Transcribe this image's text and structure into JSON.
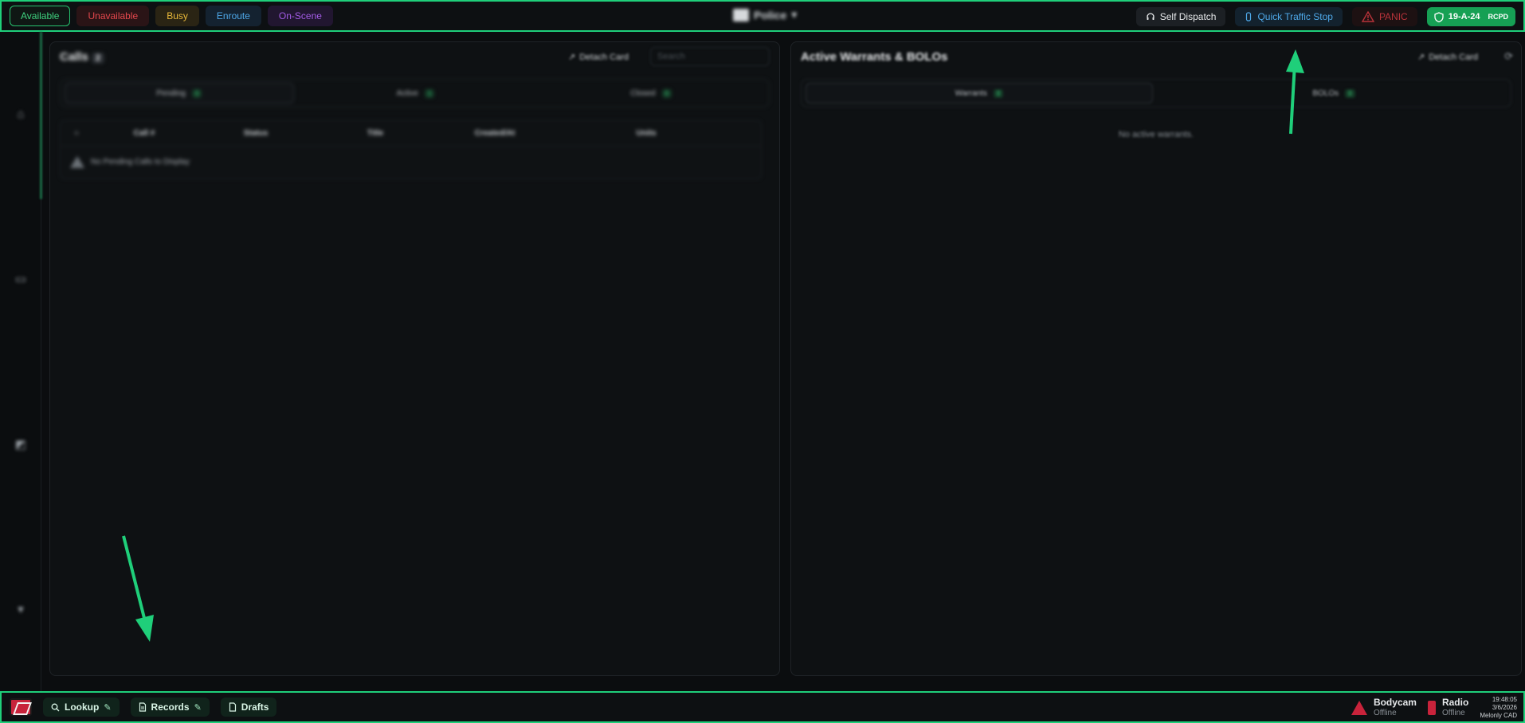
{
  "topbar": {
    "statuses": [
      {
        "label": "Available"
      },
      {
        "label": "Unavailable"
      },
      {
        "label": "Busy"
      },
      {
        "label": "Enroute"
      },
      {
        "label": "On-Scene"
      }
    ],
    "agency": "Police",
    "self_dispatch": "Self Dispatch",
    "quick_traffic_stop": "Quick Traffic Stop",
    "panic": "PANIC",
    "unit_callsign": "19-A-24",
    "unit_agency": "RCPD"
  },
  "calls_panel": {
    "title": "Calls",
    "count": "2",
    "detach": "Detach Card",
    "search_placeholder": "Search",
    "tabs": [
      {
        "label": "Pending",
        "count": "0"
      },
      {
        "label": "Active",
        "count": "1"
      },
      {
        "label": "Closed",
        "count": "0"
      }
    ],
    "columns": [
      "Call #",
      "Status",
      "Title",
      "Created/At",
      "Units"
    ],
    "empty_message": "No Pending Calls to Display"
  },
  "warrants_panel": {
    "title": "Active Warrants & BOLOs",
    "detach": "Detach Card",
    "tabs": [
      {
        "label": "Warrants",
        "count": "0"
      },
      {
        "label": "BOLOs",
        "count": "0"
      }
    ],
    "empty_message": "No active warrants."
  },
  "bottombar": {
    "lookup": "Lookup",
    "records": "Records",
    "drafts": "Drafts",
    "bodycam": {
      "name": "Bodycam",
      "status": "Offline"
    },
    "radio": {
      "name": "Radio",
      "status": "Offline"
    },
    "clock": {
      "time": "19:48:05",
      "date": "3/6/2026",
      "app": "Melonly CAD"
    }
  },
  "colors": {
    "accent": "#1fcf7a",
    "available": "#3fd27f",
    "unavailable": "#e5484d",
    "busy": "#e9b93a",
    "enroute": "#4ea8e8",
    "onscene": "#a35ce6",
    "panic": "#b8333a"
  }
}
